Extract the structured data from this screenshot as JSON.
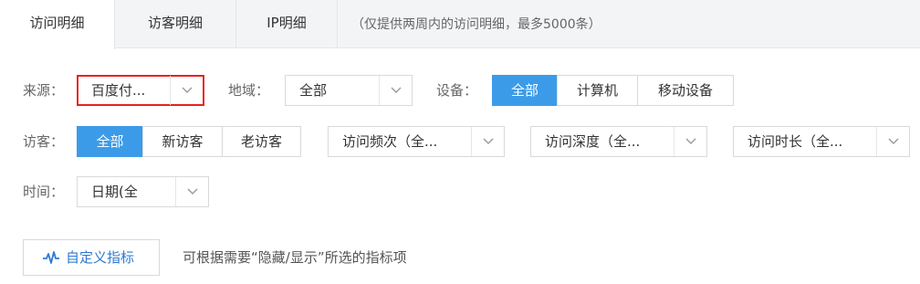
{
  "tabs": [
    {
      "label": "访问明细",
      "active": true
    },
    {
      "label": "访客明细",
      "active": false
    },
    {
      "label": "IP明细",
      "active": false
    }
  ],
  "tab_note": "（仅提供两周内的访问明细，最多5000条）",
  "filters": {
    "source": {
      "label": "来源：",
      "value": "百度付..."
    },
    "region": {
      "label": "地域：",
      "value": "全部"
    },
    "device": {
      "label": "设备：",
      "options": [
        "全部",
        "计算机",
        "移动设备"
      ],
      "selected": "全部"
    },
    "visitor": {
      "label": "访客：",
      "options": [
        "全部",
        "新访客",
        "老访客"
      ],
      "selected": "全部"
    },
    "visit_freq": {
      "value": "访问频次（全..."
    },
    "visit_depth": {
      "value": "访问深度（全..."
    },
    "visit_duration": {
      "value": "访问时长（全..."
    },
    "time": {
      "label": "时间：",
      "value": "日期(全"
    }
  },
  "custom_metrics": {
    "button_label": "自定义指标",
    "icon": "pulse-icon",
    "hint": "可根据需要“隐藏/显示”所选的指标项"
  },
  "colors": {
    "accent": "#3c9be8",
    "highlight": "#e8231f",
    "link": "#2e7ad3"
  }
}
